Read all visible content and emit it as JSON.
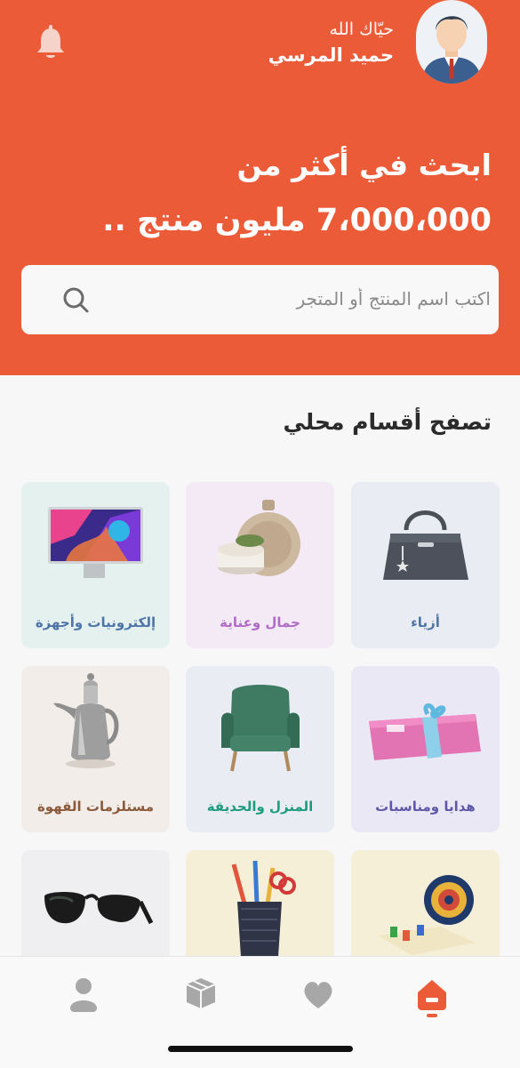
{
  "header": {
    "greeting": "حيّاك الله",
    "user_name": "حميد المرسي",
    "headline_line1": "ابحث في أكثر من",
    "headline_line2": "7،000،000 مليون منتج .."
  },
  "search": {
    "placeholder": "اكتب اسم المنتج أو المتجر",
    "value": ""
  },
  "categories_section": {
    "title": "تصفح أقسام محلي"
  },
  "categories": [
    {
      "label": "أزياء",
      "icon": "handbag-icon",
      "bg": "#e9edf3",
      "color": "#4f75a8"
    },
    {
      "label": "جمال وعناية",
      "icon": "perfume-icon",
      "bg": "#f3eaf6",
      "color": "#b06bc7"
    },
    {
      "label": "إلكترونيات وأجهزة",
      "icon": "monitor-icon",
      "bg": "#e4f1ef",
      "color": "#4f75a8"
    },
    {
      "label": "هدايا ومناسبات",
      "icon": "gift-box-icon",
      "bg": "#ebe8f5",
      "color": "#5f58a8"
    },
    {
      "label": "المنزل والحديقة",
      "icon": "armchair-icon",
      "bg": "#e9edf3",
      "color": "#1f9a7d"
    },
    {
      "label": "مستلزمات القهوة",
      "icon": "coffee-pot-icon",
      "bg": "#f3ede9",
      "color": "#8a5a3c"
    },
    {
      "label": "",
      "icon": "board-game-icon",
      "bg": "#f6efd8",
      "color": "#666666"
    },
    {
      "label": "",
      "icon": "pencil-cup-icon",
      "bg": "#f6efd8",
      "color": "#666666"
    },
    {
      "label": "",
      "icon": "sunglasses-icon",
      "bg": "#efeff1",
      "color": "#666666"
    }
  ],
  "tabbar": {
    "items": [
      {
        "icon": "home-icon",
        "active": true
      },
      {
        "icon": "heart-icon",
        "active": false
      },
      {
        "icon": "box-icon",
        "active": false
      },
      {
        "icon": "person-icon",
        "active": false
      }
    ]
  },
  "colors": {
    "brand": "#ec5b37",
    "inactive_tab": "#a7a7a7"
  }
}
